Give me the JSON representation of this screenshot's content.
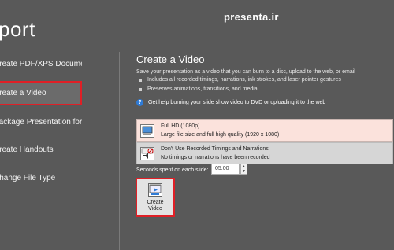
{
  "window": {
    "title": "port"
  },
  "watermark": "presenta.ir",
  "nav": {
    "items": [
      {
        "label": "Create PDF/XPS Document",
        "selected": false
      },
      {
        "label": "Create a Video",
        "selected": true
      },
      {
        "label": "Package Presentation for CD",
        "selected": false
      },
      {
        "label": "Create Handouts",
        "selected": false
      },
      {
        "label": "Change File Type",
        "selected": false
      }
    ]
  },
  "main": {
    "title": "Create a Video",
    "description": "Save your presentation as a video that you can burn to a disc, upload to the web, or email",
    "bullets": [
      "Includes all recorded timings, narrations, ink strokes, and laser pointer gestures",
      "Preserves animations, transitions, and media"
    ],
    "help_link": "Get help burning your slide show video to DVD or uploading it to the web",
    "quality": {
      "title": "Full HD (1080p)",
      "subtitle": "Large file size and full high quality (1920 x 1080)"
    },
    "timings": {
      "title": "Don't Use Recorded Timings and Narrations",
      "subtitle": "No timings or narrations have been recorded"
    },
    "seconds": {
      "label": "Seconds spent on each slide:",
      "value": "05.00"
    },
    "create_button": {
      "label_line1": "Create",
      "label_line2": "Video"
    }
  },
  "colors": {
    "background": "#595959",
    "highlight_border": "#e01f26",
    "quality_bg": "#fbe2dc"
  }
}
